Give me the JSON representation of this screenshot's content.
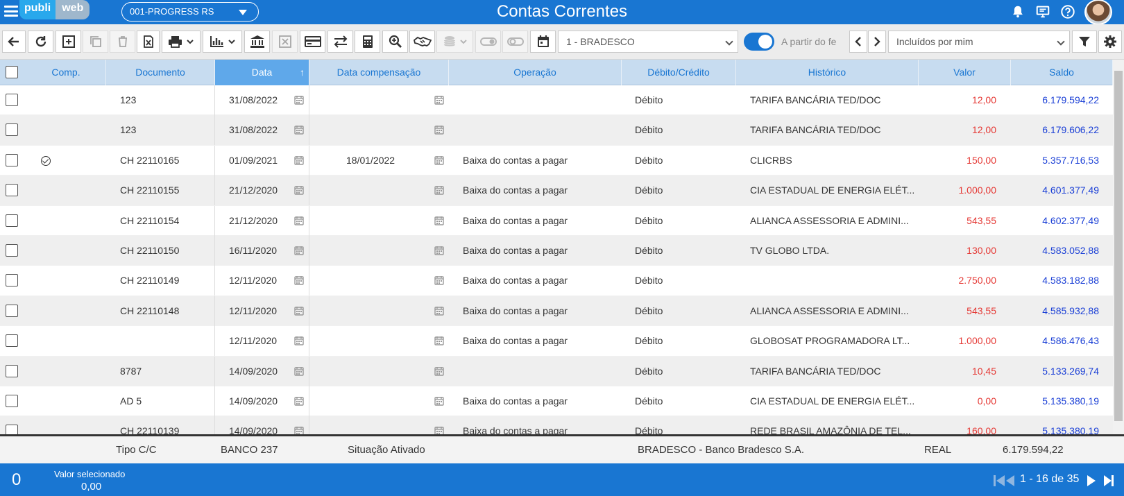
{
  "topbar": {
    "logo_left": "publi",
    "logo_right": "web",
    "company": "001-PROGRESS RS",
    "title": "Contas Correntes"
  },
  "toolbar": {
    "bank_select": "1 - BRADESCO",
    "date_filter": "A partir do fe",
    "user_filter": "Incluídos por mim"
  },
  "columns": {
    "comp": "Comp.",
    "documento": "Documento",
    "data": "Data",
    "data_compensacao": "Data compensação",
    "operacao": "Operação",
    "debito_credito": "Débito/Crédito",
    "historico": "Histórico",
    "valor": "Valor",
    "saldo": "Saldo"
  },
  "rows": [
    {
      "comp": false,
      "doc": "123",
      "data": "31/08/2022",
      "comp_date": "",
      "op": "",
      "dc": "Débito",
      "hist": "TARIFA BANCÁRIA TED/DOC",
      "valor": "12,00",
      "saldo": "6.179.594,22"
    },
    {
      "comp": false,
      "doc": "123",
      "data": "31/08/2022",
      "comp_date": "",
      "op": "",
      "dc": "Débito",
      "hist": "TARIFA BANCÁRIA TED/DOC",
      "valor": "12,00",
      "saldo": "6.179.606,22"
    },
    {
      "comp": true,
      "doc": "CH 22110165",
      "data": "01/09/2021",
      "comp_date": "18/01/2022",
      "op": "Baixa do contas a pagar",
      "dc": "Débito",
      "hist": "CLICRBS",
      "valor": "150,00",
      "saldo": "5.357.716,53"
    },
    {
      "comp": false,
      "doc": "CH 22110155",
      "data": "21/12/2020",
      "comp_date": "",
      "op": "Baixa do contas a pagar",
      "dc": "Débito",
      "hist": "CIA ESTADUAL DE ENERGIA ELÉT...",
      "valor": "1.000,00",
      "saldo": "4.601.377,49"
    },
    {
      "comp": false,
      "doc": "CH 22110154",
      "data": "21/12/2020",
      "comp_date": "",
      "op": "Baixa do contas a pagar",
      "dc": "Débito",
      "hist": "ALIANCA ASSESSORIA E ADMINI...",
      "valor": "543,55",
      "saldo": "4.602.377,49"
    },
    {
      "comp": false,
      "doc": "CH 22110150",
      "data": "16/11/2020",
      "comp_date": "",
      "op": "Baixa do contas a pagar",
      "dc": "Débito",
      "hist": "TV GLOBO LTDA.",
      "valor": "130,00",
      "saldo": "4.583.052,88"
    },
    {
      "comp": false,
      "doc": "CH 22110149",
      "data": "12/11/2020",
      "comp_date": "",
      "op": "Baixa do contas a pagar",
      "dc": "Débito",
      "hist": "",
      "valor": "2.750,00",
      "saldo": "4.583.182,88"
    },
    {
      "comp": false,
      "doc": "CH 22110148",
      "data": "12/11/2020",
      "comp_date": "",
      "op": "Baixa do contas a pagar",
      "dc": "Débito",
      "hist": "ALIANCA ASSESSORIA E ADMINI...",
      "valor": "543,55",
      "saldo": "4.585.932,88"
    },
    {
      "comp": false,
      "doc": "",
      "data": "12/11/2020",
      "comp_date": "",
      "op": "Baixa do contas a pagar",
      "dc": "Débito",
      "hist": "GLOBOSAT PROGRAMADORA LT...",
      "valor": "1.000,00",
      "saldo": "4.586.476,43"
    },
    {
      "comp": false,
      "doc": "8787",
      "data": "14/09/2020",
      "comp_date": "",
      "op": "",
      "dc": "Débito",
      "hist": "TARIFA BANCÁRIA TED/DOC",
      "valor": "10,45",
      "saldo": "5.133.269,74"
    },
    {
      "comp": false,
      "doc": "AD 5",
      "data": "14/09/2020",
      "comp_date": "",
      "op": "Baixa do contas a pagar",
      "dc": "Débito",
      "hist": "CIA ESTADUAL DE ENERGIA ELÉT...",
      "valor": "0,00",
      "saldo": "5.135.380,19"
    },
    {
      "comp": false,
      "doc": "CH 22110139",
      "data": "14/09/2020",
      "comp_date": "",
      "op": "Baixa do contas a pagar",
      "dc": "Débito",
      "hist": "REDE BRASIL AMAZÔNIA DE TEL...",
      "valor": "160,00",
      "saldo": "5.135.380,19"
    }
  ],
  "summary": {
    "tipo": "Tipo C/C",
    "banco": "BANCO 237",
    "situacao": "Situação Ativado",
    "banco_nome": "BRADESCO - Banco Bradesco S.A.",
    "moeda": "REAL",
    "saldo": "6.179.594,22"
  },
  "footer": {
    "count": "0",
    "valor_label": "Valor selecionado",
    "valor": "0,00",
    "pagination": "1 - 16 de 35"
  },
  "colors": {
    "primary": "#1976d2",
    "header_bg": "#c7dcf0",
    "sorted_header": "#5fa8ea",
    "valor": "#e53935",
    "saldo": "#1a3fd6"
  }
}
